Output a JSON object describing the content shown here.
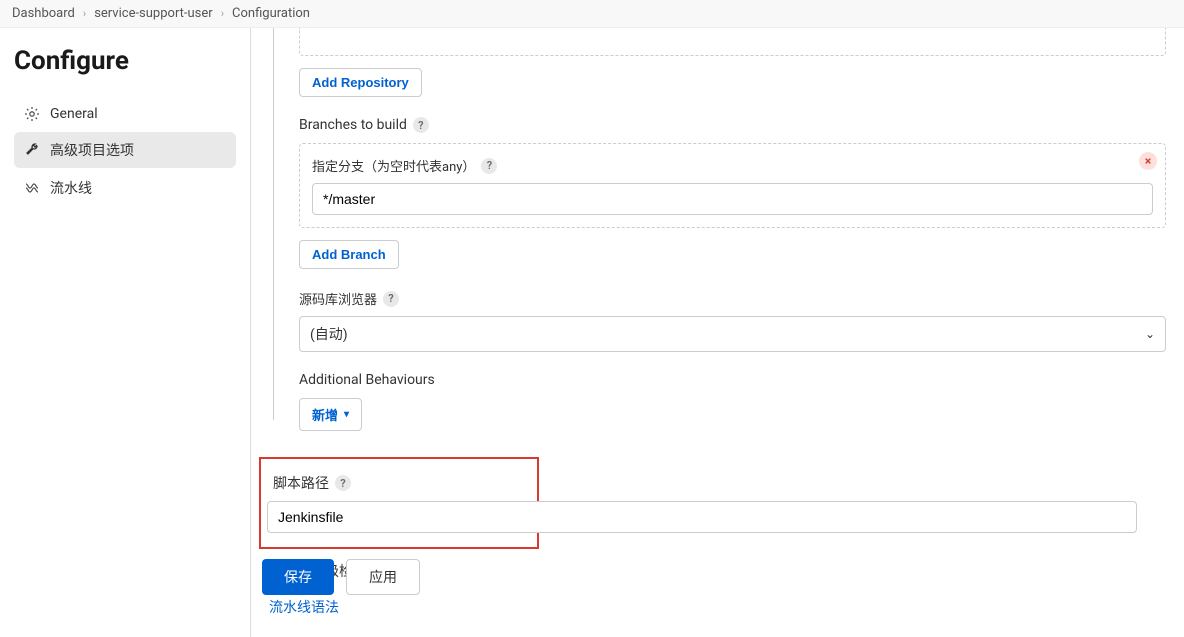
{
  "breadcrumb": {
    "items": [
      "Dashboard",
      "service-support-user",
      "Configuration"
    ]
  },
  "sidebar": {
    "title": "Configure",
    "items": [
      {
        "label": "General",
        "icon": "gear"
      },
      {
        "label": "高级项目选项",
        "icon": "wrench"
      },
      {
        "label": "流水线",
        "icon": "pipeline"
      }
    ]
  },
  "content": {
    "addRepoBtn": "Add Repository",
    "branchesTitle": "Branches to build",
    "branchSpecLabel": "指定分支（为空时代表any）",
    "branchSpecValue": "*/master",
    "addBranchBtn": "Add Branch",
    "scmBrowserLabel": "源码库浏览器",
    "scmBrowserValue": "(自动)",
    "additionalLabel": "Additional Behaviours",
    "addBehaviourBtn": "新增",
    "scriptPathLabel": "脚本路径",
    "scriptPathValue": "Jenkinsfile",
    "lightweightLabel": "轻量级检出",
    "pipelineSyntaxLink": "流水线语法",
    "saveBtn": "保存",
    "applyBtn": "应用"
  }
}
